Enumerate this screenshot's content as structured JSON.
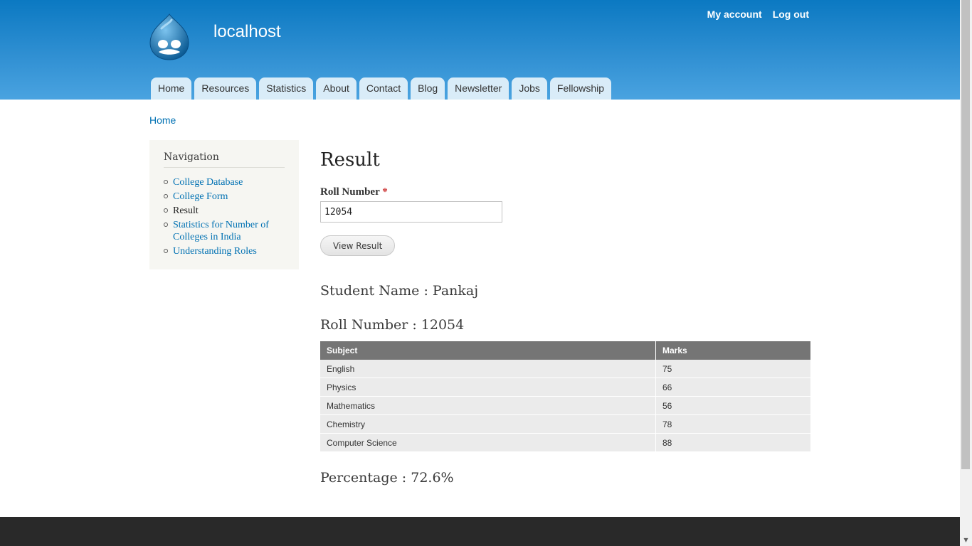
{
  "header": {
    "site_name": "localhost",
    "secondary_menu": [
      {
        "label": "My account"
      },
      {
        "label": "Log out"
      }
    ],
    "main_menu": [
      {
        "label": "Home"
      },
      {
        "label": "Resources"
      },
      {
        "label": "Statistics"
      },
      {
        "label": "About"
      },
      {
        "label": "Contact"
      },
      {
        "label": "Blog"
      },
      {
        "label": "Newsletter"
      },
      {
        "label": "Jobs"
      },
      {
        "label": "Fellowship"
      }
    ]
  },
  "breadcrumb": {
    "home": "Home"
  },
  "sidebar": {
    "title": "Navigation",
    "items": [
      {
        "label": "College Database"
      },
      {
        "label": "College Form"
      },
      {
        "label": "Result"
      },
      {
        "label": "Statistics for Number of Colleges in India"
      },
      {
        "label": "Understanding Roles"
      }
    ]
  },
  "content": {
    "page_title": "Result",
    "form": {
      "roll_label": "Roll Number",
      "required_marker": "*",
      "roll_value": "12054",
      "submit_label": "View Result"
    },
    "student_name": "Student Name : Pankaj",
    "roll_number": "Roll Number : 12054",
    "table": {
      "headers": [
        "Subject",
        "Marks"
      ],
      "rows": [
        [
          "English",
          "75"
        ],
        [
          "Physics",
          "66"
        ],
        [
          "Mathematics",
          "56"
        ],
        [
          "Chemistry",
          "78"
        ],
        [
          "Computer Science",
          "88"
        ]
      ]
    },
    "percentage": "Percentage : 72.6%"
  },
  "colors": {
    "header_top": "#0b79c2",
    "header_bottom": "#4aa3e0",
    "tab_bg": "#d9ecf8",
    "link": "#0071b3",
    "footer": "#292929",
    "table_header": "#757575"
  }
}
